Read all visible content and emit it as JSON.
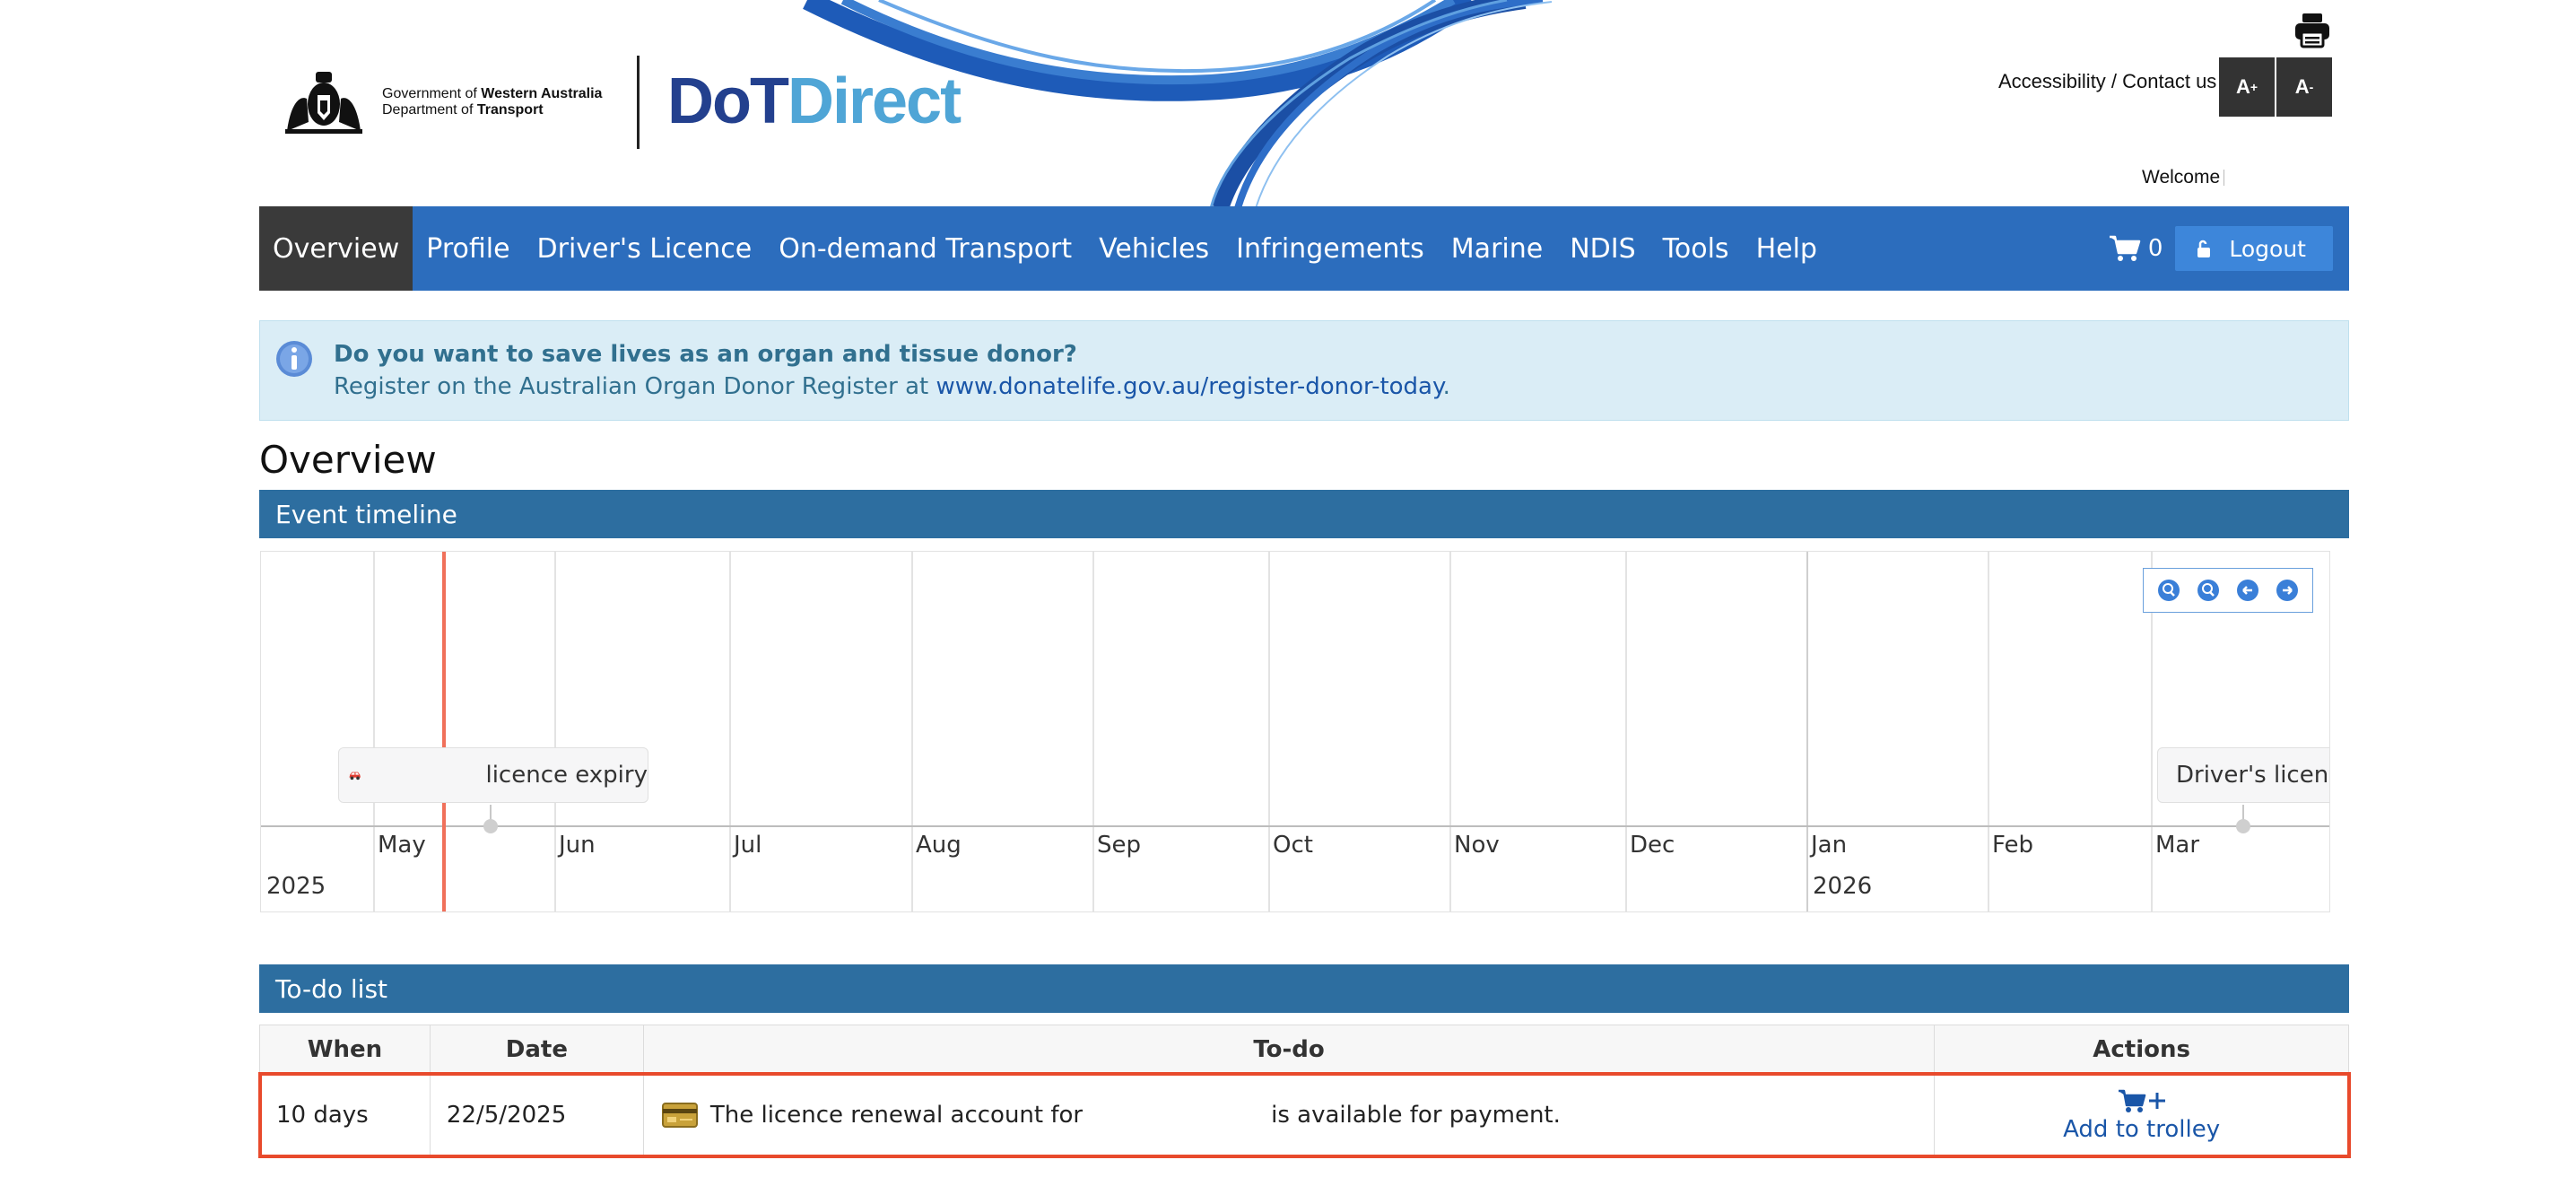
{
  "header": {
    "gov_line1_prefix": "Government of ",
    "gov_line1_bold": "Western Australia",
    "gov_line2_prefix": "Department of ",
    "gov_line2_bold": "Transport",
    "brand_dot": "DoT",
    "brand_direct": "Direct",
    "accessibility_link": "Accessibility / Contact us",
    "font_increase": "A",
    "font_increase_sup": "+",
    "font_decrease": "A",
    "font_decrease_sup": "-",
    "welcome": "Welcome"
  },
  "nav": {
    "items": [
      {
        "label": "Overview",
        "active": true
      },
      {
        "label": "Profile"
      },
      {
        "label": "Driver's Licence"
      },
      {
        "label": "On-demand Transport"
      },
      {
        "label": "Vehicles"
      },
      {
        "label": "Infringements"
      },
      {
        "label": "Marine"
      },
      {
        "label": "NDIS"
      },
      {
        "label": "Tools"
      },
      {
        "label": "Help"
      }
    ],
    "cart_count": "0",
    "logout_label": "Logout"
  },
  "alert": {
    "title": "Do you want to save lives as an organ and tissue donor?",
    "body_prefix": "Register on the Australian Organ Donor Register at ",
    "link": "www.donatelife.gov.au/register-donor-today",
    "body_suffix": "."
  },
  "overview": {
    "title": "Overview",
    "timeline_heading": "Event timeline",
    "months": [
      "May",
      "Jun",
      "Jul",
      "Aug",
      "Sep",
      "Oct",
      "Nov",
      "Dec",
      "Jan",
      "Feb",
      "Mar"
    ],
    "years": [
      "2025",
      "2026"
    ],
    "events": [
      {
        "label": "licence expiry",
        "icon": "car-icon"
      },
      {
        "label": "Driver's licence",
        "icon": "id-card-icon"
      }
    ]
  },
  "todo": {
    "heading": "To-do list",
    "columns": [
      "When",
      "Date",
      "To-do",
      "Actions"
    ],
    "rows": [
      {
        "when": "10 days",
        "date": "22/5/2025",
        "text_before": "The licence renewal account for",
        "text_after": "is available for payment.",
        "action": "Add to trolley"
      }
    ]
  },
  "colors": {
    "nav_bg": "#2c6dbd",
    "nav_active": "#3a3a3a",
    "panel_head": "#2d6ea0",
    "alert_bg": "#daedf6",
    "today_marker": "#f0705a",
    "highlight": "#e84a2c"
  }
}
